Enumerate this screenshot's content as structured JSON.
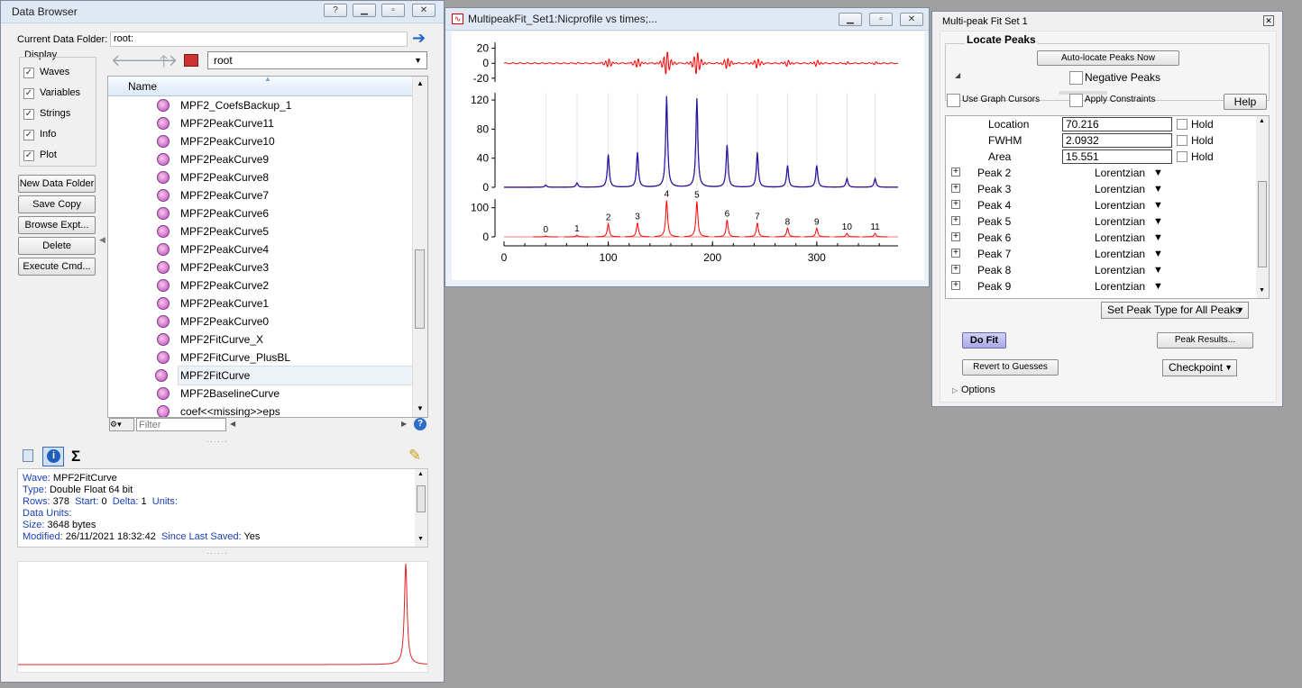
{
  "data_browser": {
    "title": "Data Browser",
    "current_folder_label": "Current Data Folder:",
    "current_folder_value": "root:",
    "display_label": "Display",
    "display_options": [
      {
        "label": "Waves",
        "checked": true
      },
      {
        "label": "Variables",
        "checked": true
      },
      {
        "label": "Strings",
        "checked": true
      },
      {
        "label": "Info",
        "checked": true
      },
      {
        "label": "Plot",
        "checked": true
      }
    ],
    "buttons": [
      "New Data Folder",
      "Save Copy",
      "Browse Expt...",
      "Delete",
      "Execute Cmd..."
    ],
    "folder_dropdown": "root",
    "column_header": "Name",
    "items": [
      "MPF2_CoefsBackup_1",
      "MPF2PeakCurve11",
      "MPF2PeakCurve10",
      "MPF2PeakCurve9",
      "MPF2PeakCurve8",
      "MPF2PeakCurve7",
      "MPF2PeakCurve6",
      "MPF2PeakCurve5",
      "MPF2PeakCurve4",
      "MPF2PeakCurve3",
      "MPF2PeakCurve2",
      "MPF2PeakCurve1",
      "MPF2PeakCurve0",
      "MPF2FitCurve_X",
      "MPF2FitCurve_PlusBL",
      "MPF2FitCurve",
      "MPF2BaselineCurve",
      "coef<<missing>>eps"
    ],
    "selected_item": "MPF2FitCurve",
    "filter_placeholder": "Filter",
    "sigma_symbol": "Σ",
    "info": {
      "wave_label": "Wave:",
      "wave_value": "MPF2FitCurve",
      "type_label": "Type:",
      "type_value": "Double Float 64 bit",
      "rows_label": "Rows:",
      "rows_value": "378",
      "start_label": "Start:",
      "start_value": "0",
      "delta_label": "Delta:",
      "delta_value": "1",
      "units_label": "Units:",
      "data_units_label": "Data Units:",
      "size_label": "Size:",
      "size_value": "3648 bytes",
      "modified_label": "Modified:",
      "modified_value": "26/11/2021 18:32:42",
      "since_label": "Since Last Saved:",
      "since_value": "Yes"
    }
  },
  "graph_window": {
    "title": "MultipeakFit_Set1:Nicprofile vs times;...",
    "peak_labels": [
      "0",
      "1",
      "2",
      "3",
      "4",
      "5",
      "6",
      "7",
      "8",
      "9",
      "10",
      "11"
    ],
    "x_ticks": [
      "0",
      "100",
      "200",
      "300"
    ],
    "top_ticks": [
      "20",
      "0",
      "-20"
    ],
    "mid_ticks": [
      "120",
      "80",
      "40",
      "0"
    ],
    "bottom_ticks": [
      "100",
      "0"
    ]
  },
  "chart_data": {
    "type": "line",
    "title": "",
    "x_range": [
      0,
      378
    ],
    "panels": [
      {
        "name": "residual",
        "ylim": [
          -25,
          28
        ],
        "color": "#ff0000"
      },
      {
        "name": "fit",
        "ylim": [
          0,
          130
        ],
        "colors": [
          "#ff0000",
          "#1a1aa8"
        ]
      },
      {
        "name": "peaks",
        "ylim": [
          0,
          130
        ],
        "color": "#ff0000"
      }
    ],
    "peaks": [
      {
        "label": "0",
        "x": 40,
        "height": 3
      },
      {
        "label": "1",
        "x": 70,
        "height": 6
      },
      {
        "label": "2",
        "x": 100,
        "height": 45
      },
      {
        "label": "3",
        "x": 128,
        "height": 48
      },
      {
        "label": "4",
        "x": 156,
        "height": 125
      },
      {
        "label": "5",
        "x": 185,
        "height": 122
      },
      {
        "label": "6",
        "x": 214,
        "height": 58
      },
      {
        "label": "7",
        "x": 243,
        "height": 48
      },
      {
        "label": "8",
        "x": 272,
        "height": 30
      },
      {
        "label": "9",
        "x": 300,
        "height": 30
      },
      {
        "label": "10",
        "x": 329,
        "height": 12
      },
      {
        "label": "11",
        "x": 356,
        "height": 12
      }
    ],
    "colors": {
      "data": "#1a1aa8",
      "fit": "#ff0000"
    }
  },
  "mpf_panel": {
    "title": "Multi-peak Fit Set 1",
    "locate_peaks_label": "Locate Peaks",
    "auto_locate_button": "Auto-locate Peaks Now",
    "negative_peaks_label": "Negative Peaks",
    "use_cursors_label": "Use Graph Cursors",
    "apply_constraints_label": "Apply Constraints",
    "help_button": "Help",
    "params": [
      {
        "label": "Location",
        "value": "70.216",
        "hold": "Hold"
      },
      {
        "label": "FWHM",
        "value": "2.0932",
        "hold": "Hold"
      },
      {
        "label": "Area",
        "value": "15.551",
        "hold": "Hold"
      }
    ],
    "peaks": [
      {
        "name": "Peak 2",
        "type": "Lorentzian"
      },
      {
        "name": "Peak 3",
        "type": "Lorentzian"
      },
      {
        "name": "Peak 4",
        "type": "Lorentzian"
      },
      {
        "name": "Peak 5",
        "type": "Lorentzian"
      },
      {
        "name": "Peak 6",
        "type": "Lorentzian"
      },
      {
        "name": "Peak 7",
        "type": "Lorentzian"
      },
      {
        "name": "Peak 8",
        "type": "Lorentzian"
      },
      {
        "name": "Peak 9",
        "type": "Lorentzian"
      }
    ],
    "set_peak_type_dropdown": "Set Peak Type for All Peaks",
    "do_fit_button": "Do Fit",
    "peak_results_button": "Peak Results...",
    "revert_button": "Revert to Guesses",
    "checkpoint_dropdown": "Checkpoint",
    "options_label": "Options"
  }
}
